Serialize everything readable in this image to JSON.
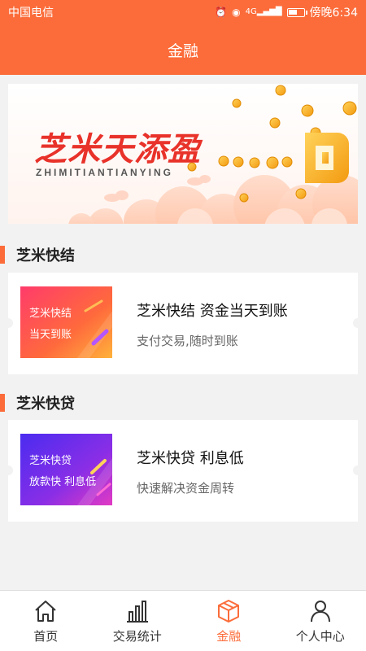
{
  "status_bar": {
    "carrier": "中国电信",
    "time": "傍晚6:34",
    "network": "4G",
    "battery_level": 0.6
  },
  "header": {
    "title": "金融"
  },
  "banner": {
    "title": "芝米天添盈",
    "subtitle": "ZHIMITIANTIANYING"
  },
  "sections": [
    {
      "heading": "芝米快结",
      "card": {
        "thumb_line1": "芝米快结",
        "thumb_line2": "当天到账",
        "title": "芝米快结 资金当天到账",
        "subtitle": "支付交易,随时到账"
      }
    },
    {
      "heading": "芝米快贷",
      "card": {
        "thumb_line1": "芝米快贷",
        "thumb_line2": "放款快 利息低",
        "title": "芝米快贷 利息低",
        "subtitle": "快速解决资金周转"
      }
    }
  ],
  "tabs": [
    {
      "label": "首页",
      "icon": "home-icon"
    },
    {
      "label": "交易统计",
      "icon": "bar-chart-icon"
    },
    {
      "label": "金融",
      "icon": "box-icon",
      "active": true
    },
    {
      "label": "个人中心",
      "icon": "person-icon"
    }
  ],
  "colors": {
    "accent": "#fb6c3a",
    "banner_red": "#e8322a",
    "background": "#f2f2f2"
  }
}
